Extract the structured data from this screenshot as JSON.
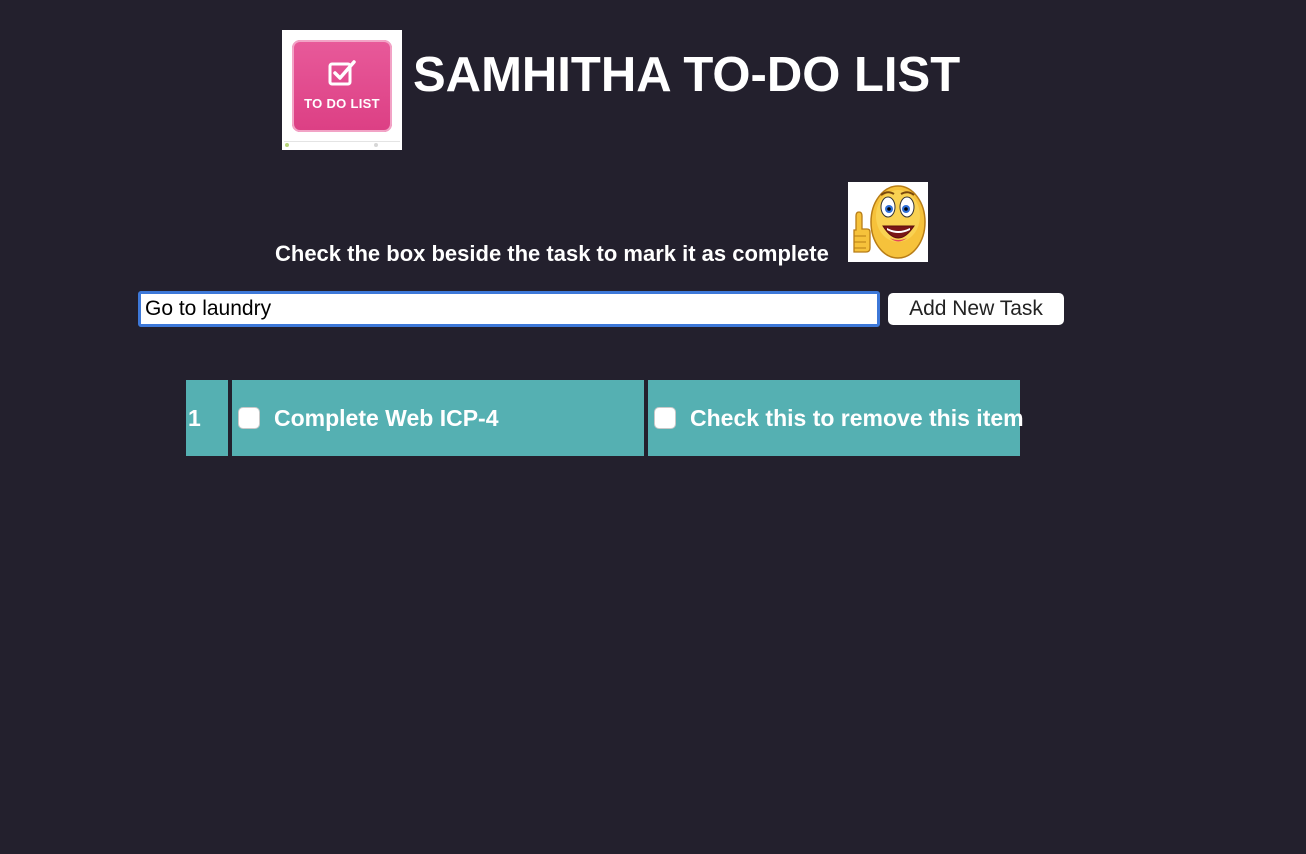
{
  "header": {
    "logo_text": "TO DO LIST",
    "title": "SAMHITHA TO-DO LIST"
  },
  "instruction": {
    "text": "Check the box beside the task to mark it as complete",
    "emoji_icon": "thumbs-up-smiley-icon"
  },
  "new_task": {
    "value": "Go to laundry",
    "button_label": "Add New Task"
  },
  "tasks": [
    {
      "index": "1",
      "label": "Complete Web ICP-4",
      "completed": false,
      "remove_label": "Check this to remove this item",
      "remove_checked": false
    }
  ],
  "colors": {
    "background": "#23202d",
    "row": "#55b0b2",
    "logo": "#dc3f84",
    "input_focus": "#3d78d8"
  }
}
